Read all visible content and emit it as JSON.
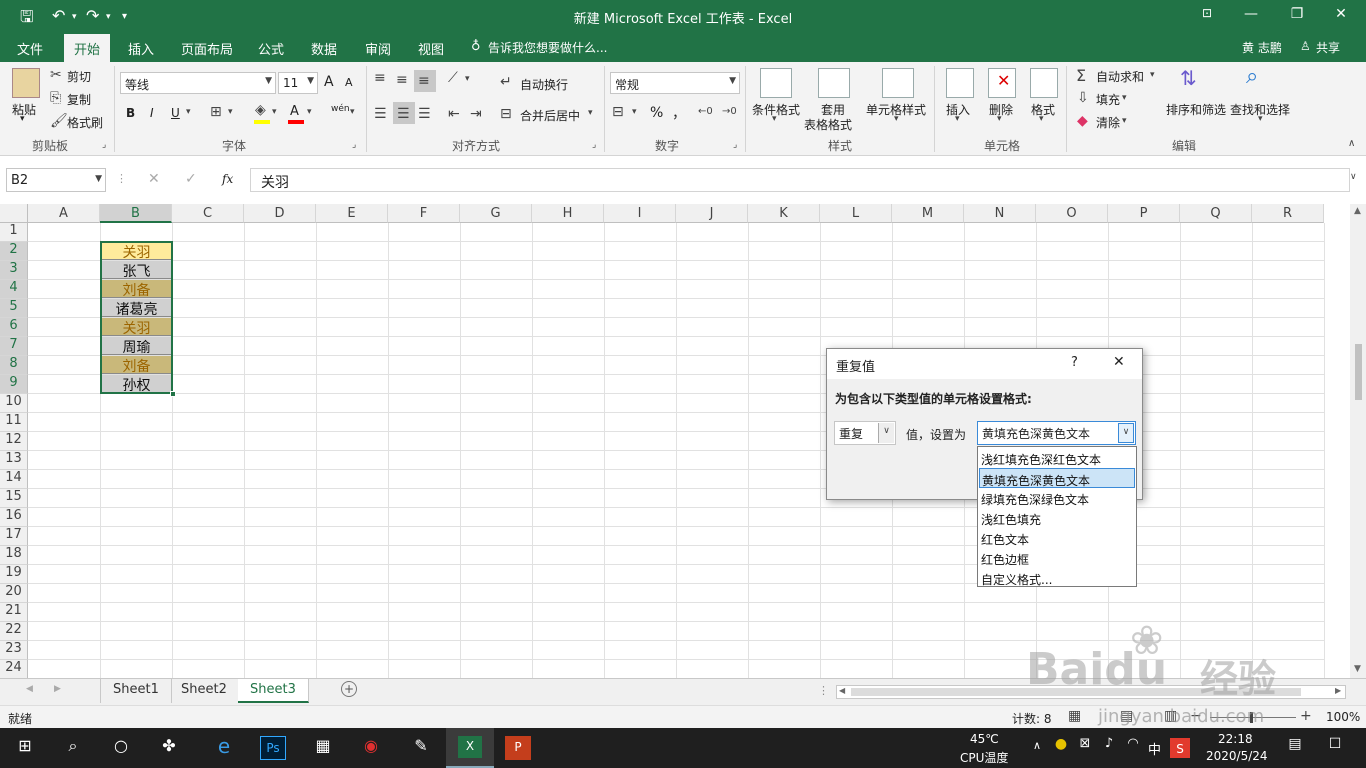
{
  "window": {
    "title": "新建 Microsoft Excel 工作表 - Excel",
    "controls": [
      "—",
      "❐",
      "✕"
    ]
  },
  "menu": {
    "tabs": [
      "文件",
      "开始",
      "插入",
      "页面布局",
      "公式",
      "数据",
      "审阅",
      "视图"
    ],
    "active": "开始",
    "tell_me": "告诉我您想要做什么...",
    "user": "黄 志鹏",
    "share": "共享"
  },
  "ribbon": {
    "clipboard": {
      "paste": "粘贴",
      "cut": "剪切",
      "copy": "复制",
      "format_painter": "格式刷",
      "label": "剪贴板"
    },
    "font": {
      "name": "等线",
      "size": "11",
      "grow": "A",
      "shrink": "A",
      "bold": "B",
      "italic": "I",
      "underline": "U",
      "phonetic": "wén",
      "label": "字体"
    },
    "alignment": {
      "wrap": "自动换行",
      "merge": "合并后居中",
      "label": "对齐方式"
    },
    "number": {
      "format": "常规",
      "percent": "%",
      "comma": "，",
      "label": "数字"
    },
    "styles": {
      "conditional": "条件格式",
      "table_1": "套用",
      "table_2": "表格格式",
      "cell_styles": "单元格样式",
      "label": "样式"
    },
    "cells": {
      "insert": "插入",
      "delete": "删除",
      "format": "格式",
      "label": "单元格"
    },
    "editing": {
      "autosum": "自动求和",
      "fill": "填充",
      "clear": "清除",
      "sort": "排序和筛选",
      "find": "查找和选择",
      "label": "编辑"
    }
  },
  "formula_bar": {
    "name_box": "B2",
    "fx": "fx",
    "value": "关羽"
  },
  "columns": [
    "A",
    "B",
    "C",
    "D",
    "E",
    "F",
    "G",
    "H",
    "I",
    "J",
    "K",
    "L",
    "M",
    "N",
    "O",
    "P",
    "Q",
    "R"
  ],
  "rows": [
    "1",
    "2",
    "3",
    "4",
    "5",
    "6",
    "7",
    "8",
    "9",
    "10",
    "11",
    "12",
    "13",
    "14",
    "15",
    "16",
    "17",
    "18",
    "19",
    "20",
    "21",
    "22",
    "23",
    "24"
  ],
  "cells_b": [
    {
      "row": "2",
      "text": "关羽",
      "style": "dup-light"
    },
    {
      "row": "3",
      "text": "张飞",
      "style": "plain"
    },
    {
      "row": "4",
      "text": "刘备",
      "style": "dup"
    },
    {
      "row": "5",
      "text": "诸葛亮",
      "style": "plain"
    },
    {
      "row": "6",
      "text": "关羽",
      "style": "dup"
    },
    {
      "row": "7",
      "text": "周瑜",
      "style": "plain"
    },
    {
      "row": "8",
      "text": "刘备",
      "style": "dup"
    },
    {
      "row": "9",
      "text": "孙权",
      "style": "plain"
    }
  ],
  "colors": {
    "excel_green": "#217346",
    "dup_fill": "#c9b87a",
    "dup_fill_light": "#ffeb9c",
    "dup_text": "#9c6500",
    "plain_fill": "#d0d0d0"
  },
  "dialog": {
    "title": "重复值",
    "help": "?",
    "close": "✕",
    "prompt": "为包含以下类型值的单元格设置格式:",
    "type_value": "重复",
    "connector": "值，设置为",
    "format_value": "黄填充色深黄色文本",
    "options": [
      "浅红填充色深红色文本",
      "黄填充色深黄色文本",
      "绿填充色深绿色文本",
      "浅红色填充",
      "红色文本",
      "红色边框",
      "自定义格式..."
    ],
    "selected_index": 1
  },
  "sheets": {
    "tabs": [
      "Sheet1",
      "Sheet2",
      "Sheet3"
    ],
    "active": "Sheet3"
  },
  "status": {
    "ready": "就绪",
    "count": "计数: 8",
    "zoom": "100%"
  },
  "taskbar": {
    "weather": "45℃",
    "cpu": "CPU温度",
    "ime": "中",
    "time": "22:18",
    "date": "2020/5/24"
  },
  "watermark": {
    "brand": "Baidu",
    "cn": "经验",
    "url": "jingyan.baidu.com"
  }
}
